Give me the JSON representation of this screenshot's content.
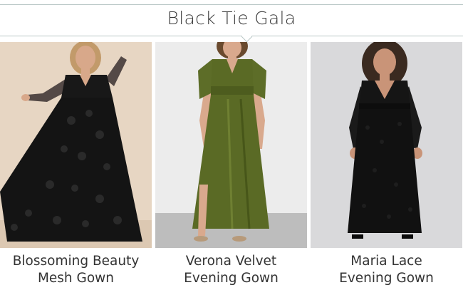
{
  "header": {
    "title": "Black Tie Gala"
  },
  "products": [
    {
      "name_line1": "Blossoming Beauty",
      "name_line2": "Mesh Gown",
      "image": "model-black-floral-mesh-gown",
      "colors": {
        "background": "#e7d6c3",
        "dress": "#141414",
        "skin": "#d8a88a",
        "hair": "#c29a6a"
      }
    },
    {
      "name_line1": "Verona Velvet",
      "name_line2": "Evening Gown",
      "image": "model-olive-velvet-gown",
      "colors": {
        "background": "#ececec",
        "dress": "#5a6a25",
        "skin": "#d9a98d",
        "hair": "#6a4a2e"
      }
    },
    {
      "name_line1": "Maria Lace",
      "name_line2": "Evening Gown",
      "image": "model-black-lace-gown",
      "colors": {
        "background": "#d9d9db",
        "dress": "#111111",
        "skin": "#c99478",
        "hair": "#3a2a20"
      }
    }
  ]
}
